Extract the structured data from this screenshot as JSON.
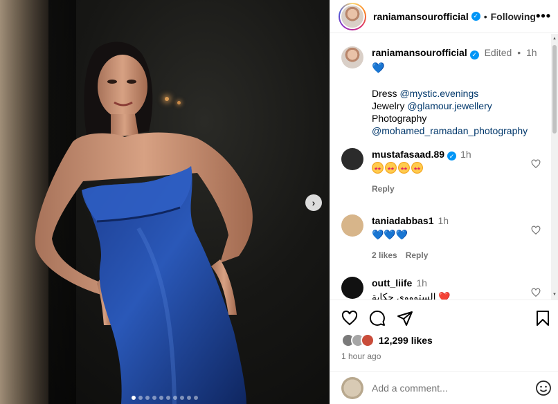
{
  "post": {
    "photo_alt": "Woman in blue strapless velvet gown",
    "carousel_count": 10,
    "carousel_active": 0
  },
  "header": {
    "username": "raniamansourofficial",
    "follow_label": "Following",
    "separator": "•",
    "more_label": "•••"
  },
  "caption": {
    "username": "raniamansourofficial",
    "edited": "Edited",
    "dot": "•",
    "time": "1h",
    "heart": "💙",
    "lines": [
      {
        "prefix": "Dress ",
        "mention": "@mystic.evenings"
      },
      {
        "prefix": "Jewelry ",
        "mention": "@glamour.jewellery"
      },
      {
        "prefix": "Photography",
        "mention": ""
      },
      {
        "prefix": "",
        "mention": "@mohamed_ramadan_photography"
      }
    ]
  },
  "comments": [
    {
      "username": "mustafasaad.89",
      "verified": true,
      "time": "1h",
      "text": "",
      "emoji_count": 4,
      "likes": "",
      "reply": "Reply",
      "avatar_color": "#2b2b2b"
    },
    {
      "username": "taniadabbas1",
      "verified": false,
      "time": "1h",
      "text": "💙💙💙",
      "emoji_count": 0,
      "likes": "2 likes",
      "reply": "Reply",
      "avatar_color": "#d7b58a"
    },
    {
      "username": "outt_liife",
      "verified": false,
      "time": "1h",
      "text": "الستوووي حكاية ❤️",
      "emoji_count": 0,
      "likes": "",
      "reply": "",
      "avatar_color": "#111111"
    }
  ],
  "actions": {
    "like_count": "12,299 likes",
    "time_ago": "1 hour ago"
  },
  "add_comment": {
    "placeholder": "Add a comment..."
  },
  "colors": {
    "link": "#00376b",
    "verified": "#0095f6",
    "muted": "#737373"
  },
  "icons": [
    "heart-icon",
    "comment-icon",
    "share-icon",
    "bookmark-icon",
    "emoji-icon",
    "chevron-right-icon",
    "more-icon"
  ]
}
